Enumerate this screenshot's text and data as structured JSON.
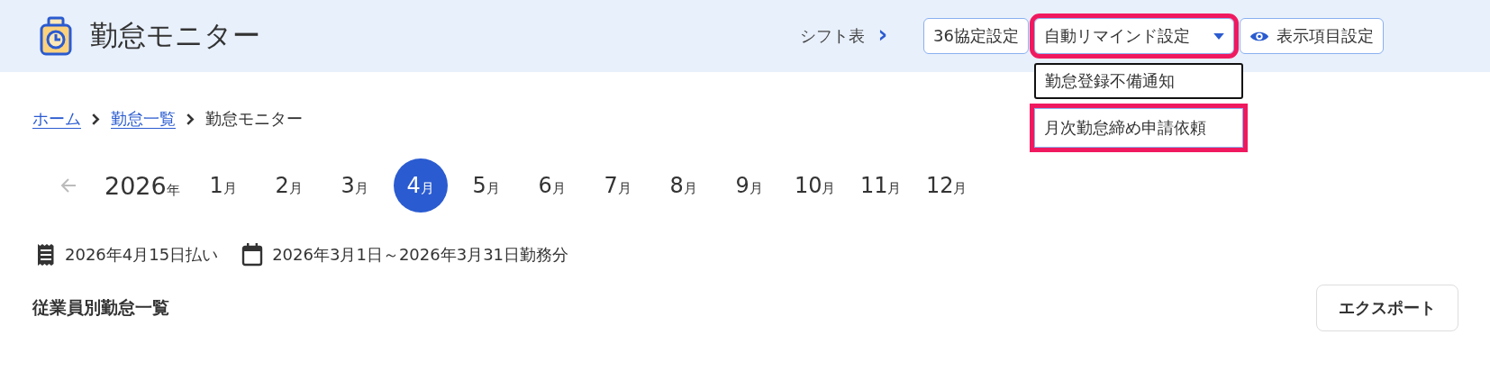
{
  "header": {
    "title": "勤怠モニター",
    "shift_link": "シフト表",
    "chevron": "›",
    "buttons": [
      {
        "kind": "plain",
        "label": "36協定設定",
        "highlighted": false
      },
      {
        "kind": "dropdown",
        "label": "自動リマインド設定",
        "highlighted": true,
        "expanded": true
      },
      {
        "kind": "eye",
        "label": "表示項目設定",
        "highlighted": false
      }
    ]
  },
  "dropdown_menu": [
    {
      "label": "勤怠登録不備通知",
      "highlighted": false
    },
    {
      "label": "月次勤怠締め申請依頼",
      "highlighted": true
    }
  ],
  "breadcrumb": [
    {
      "label": "ホーム",
      "link": true
    },
    {
      "label": "勤怠一覧",
      "link": true
    },
    {
      "label": "勤怠モニター",
      "link": false
    }
  ],
  "year": {
    "number": "2026",
    "unit": "年"
  },
  "months": [
    {
      "number": "1",
      "unit": "月",
      "selected": false
    },
    {
      "number": "2",
      "unit": "月",
      "selected": false
    },
    {
      "number": "3",
      "unit": "月",
      "selected": false
    },
    {
      "number": "4",
      "unit": "月",
      "selected": true
    },
    {
      "number": "5",
      "unit": "月",
      "selected": false
    },
    {
      "number": "6",
      "unit": "月",
      "selected": false
    },
    {
      "number": "7",
      "unit": "月",
      "selected": false
    },
    {
      "number": "8",
      "unit": "月",
      "selected": false
    },
    {
      "number": "9",
      "unit": "月",
      "selected": false
    },
    {
      "number": "10",
      "unit": "月",
      "selected": false
    },
    {
      "number": "11",
      "unit": "月",
      "selected": false
    },
    {
      "number": "12",
      "unit": "月",
      "selected": false
    }
  ],
  "pay_date": "2026年4月15日払い",
  "work_period": "2026年3月1日～2026年3月31日勤務分",
  "section_title": "従業員別勤怠一覧",
  "export_button": "エクスポート"
}
